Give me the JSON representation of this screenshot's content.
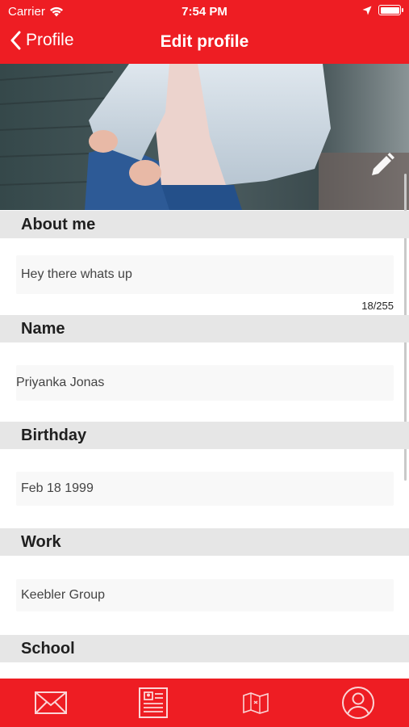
{
  "status_bar": {
    "carrier": "Carrier",
    "time": "7:54 PM"
  },
  "nav": {
    "back_label": "Profile",
    "title": "Edit profile"
  },
  "sections": {
    "about": {
      "title": "About me",
      "value": "Hey there whats up",
      "counter": "18/255"
    },
    "name": {
      "title": "Name",
      "value": "Priyanka Jonas"
    },
    "birthday": {
      "title": "Birthday",
      "value": "Feb 18 1999"
    },
    "work": {
      "title": "Work",
      "value": "Keebler Group"
    },
    "school": {
      "title": "School"
    }
  },
  "tabbar": {
    "tabs": [
      "mail-icon",
      "newsfeed-icon",
      "map-icon",
      "profile-icon"
    ]
  },
  "colors": {
    "accent": "#ee1d23",
    "section_bg": "#e6e6e6",
    "field_bg": "#f8f8f8"
  }
}
